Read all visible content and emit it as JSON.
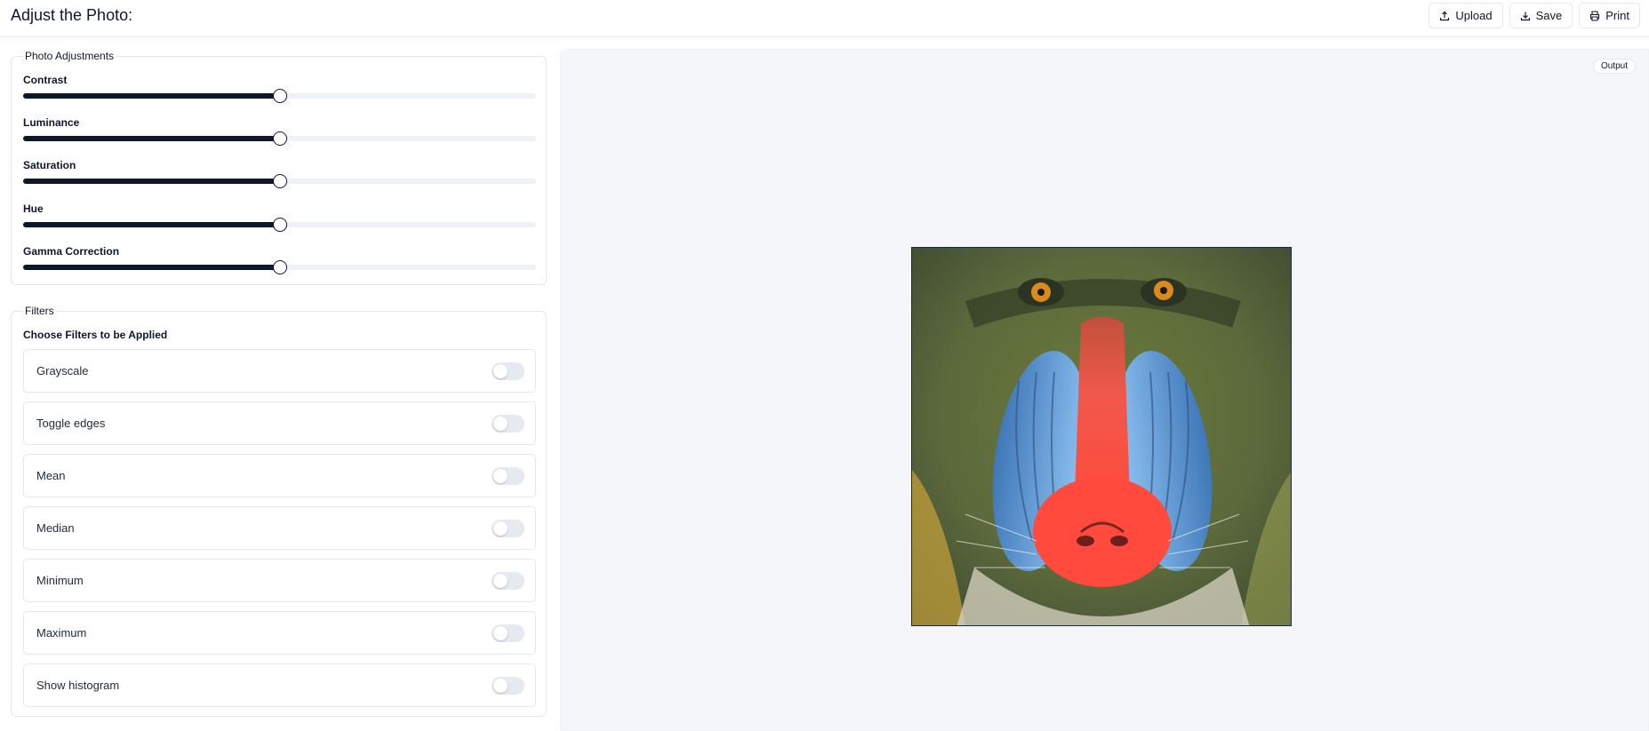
{
  "header": {
    "title": "Adjust the Photo:",
    "buttons": {
      "upload": "Upload",
      "save": "Save",
      "print": "Print"
    }
  },
  "adjustments": {
    "legend": "Photo Adjustments",
    "sliders": [
      {
        "label": "Contrast",
        "value": 0.5
      },
      {
        "label": "Luminance",
        "value": 0.5
      },
      {
        "label": "Saturation",
        "value": 0.5
      },
      {
        "label": "Hue",
        "value": 0.5
      },
      {
        "label": "Gamma Correction",
        "value": 0.5
      }
    ]
  },
  "filters": {
    "legend": "Filters",
    "subtitle": "Choose Filters to be Applied",
    "items": [
      {
        "label": "Grayscale",
        "on": false
      },
      {
        "label": "Toggle edges",
        "on": false
      },
      {
        "label": "Mean",
        "on": false
      },
      {
        "label": "Median",
        "on": false
      },
      {
        "label": "Minimum",
        "on": false
      },
      {
        "label": "Maximum",
        "on": false
      },
      {
        "label": "Show histogram",
        "on": false
      }
    ]
  },
  "output": {
    "badge": "Output"
  },
  "colors": {
    "accent": "#0f172a",
    "track": "#eef2f7",
    "toggle_off": "#e5e9f0",
    "panel_bg": "#f4f6f9"
  }
}
